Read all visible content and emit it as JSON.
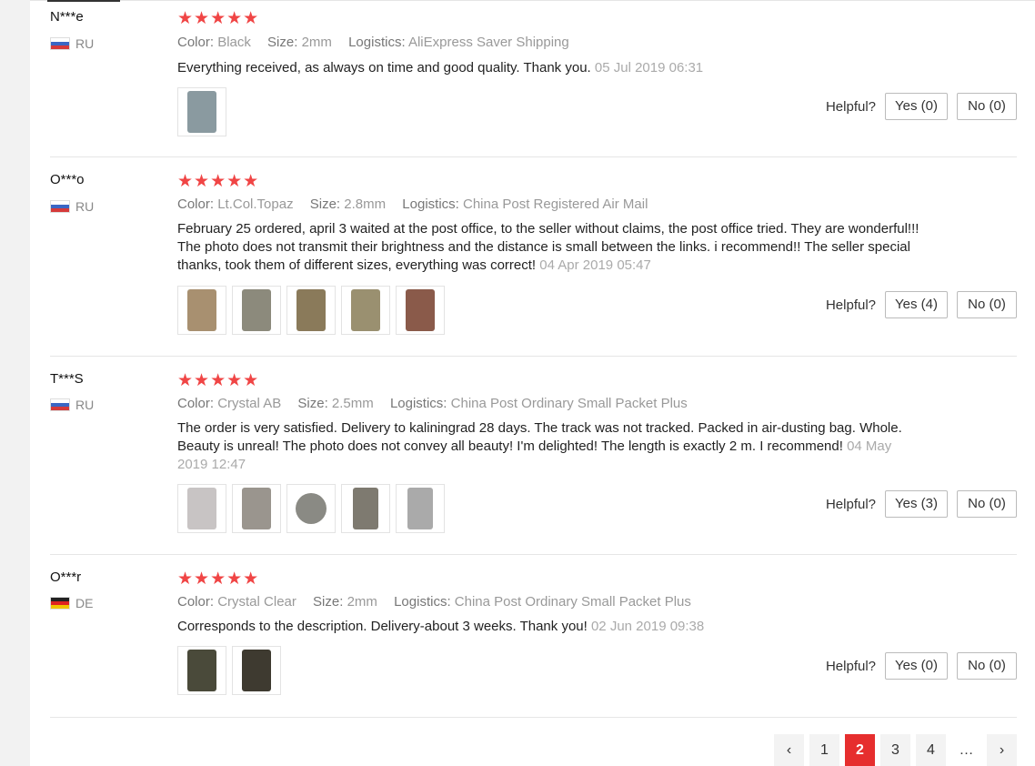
{
  "labels": {
    "color": "Color:",
    "size": "Size:",
    "logistics": "Logistics:",
    "helpful": "Helpful?"
  },
  "stars": "★★★★★",
  "reviews": [
    {
      "user": "N***e",
      "country": "RU",
      "flag": "ru",
      "color": "Black",
      "size": "2mm",
      "logistics": "AliExpress Saver Shipping",
      "text": "Everything received, as always on time and good quality. Thank you.",
      "date": "05 Jul 2019 06:31",
      "yes": "Yes (0)",
      "no": "No (0)",
      "thumb_colors": [
        "#8a9aa0"
      ]
    },
    {
      "user": "O***o",
      "country": "RU",
      "flag": "ru",
      "color": "Lt.Col.Topaz",
      "size": "2.8mm",
      "logistics": "China Post Registered Air Mail",
      "text": "February 25 ordered, april 3 waited at the post office, to the seller without claims, the post office tried. They are wonderful!!! The photo does not transmit their brightness and the distance is small between the links. i recommend!! The seller special thanks, took them of different sizes, everything was correct!",
      "date": "04 Apr 2019 05:47",
      "yes": "Yes (4)",
      "no": "No (0)",
      "thumb_colors": [
        "#a89070",
        "#8c8a7c",
        "#8a7a5a",
        "#9a9070",
        "#8a5a4a"
      ]
    },
    {
      "user": "T***S",
      "country": "RU",
      "flag": "ru",
      "color": "Crystal AB",
      "size": "2.5mm",
      "logistics": "China Post Ordinary Small Packet Plus",
      "text": "The order is very satisfied. Delivery to kaliningrad 28 days. The track was not tracked. Packed in air-dusting bag. Whole. Beauty is unreal! The photo does not convey all beauty! I'm delighted! The length is exactly 2 m. I recommend!",
      "date": "04 May 2019 12:47",
      "yes": "Yes (3)",
      "no": "No (0)",
      "thumb_colors": [
        "#c8c4c4",
        "#9a958e",
        "#8a8a84",
        "#7e7a70",
        "#aaaaaa"
      ]
    },
    {
      "user": "O***r",
      "country": "DE",
      "flag": "de",
      "color": "Crystal Clear",
      "size": "2mm",
      "logistics": "China Post Ordinary Small Packet Plus",
      "text": "Corresponds to the description. Delivery-about 3 weeks. Thank you!",
      "date": "02 Jun 2019 09:38",
      "yes": "Yes (0)",
      "no": "No (0)",
      "thumb_colors": [
        "#4a4a3a",
        "#3e3a30"
      ]
    }
  ],
  "pagination": {
    "prev": "‹",
    "pages": [
      "1",
      "2",
      "3",
      "4"
    ],
    "current": "2",
    "ellipsis": "…",
    "next": "›"
  }
}
